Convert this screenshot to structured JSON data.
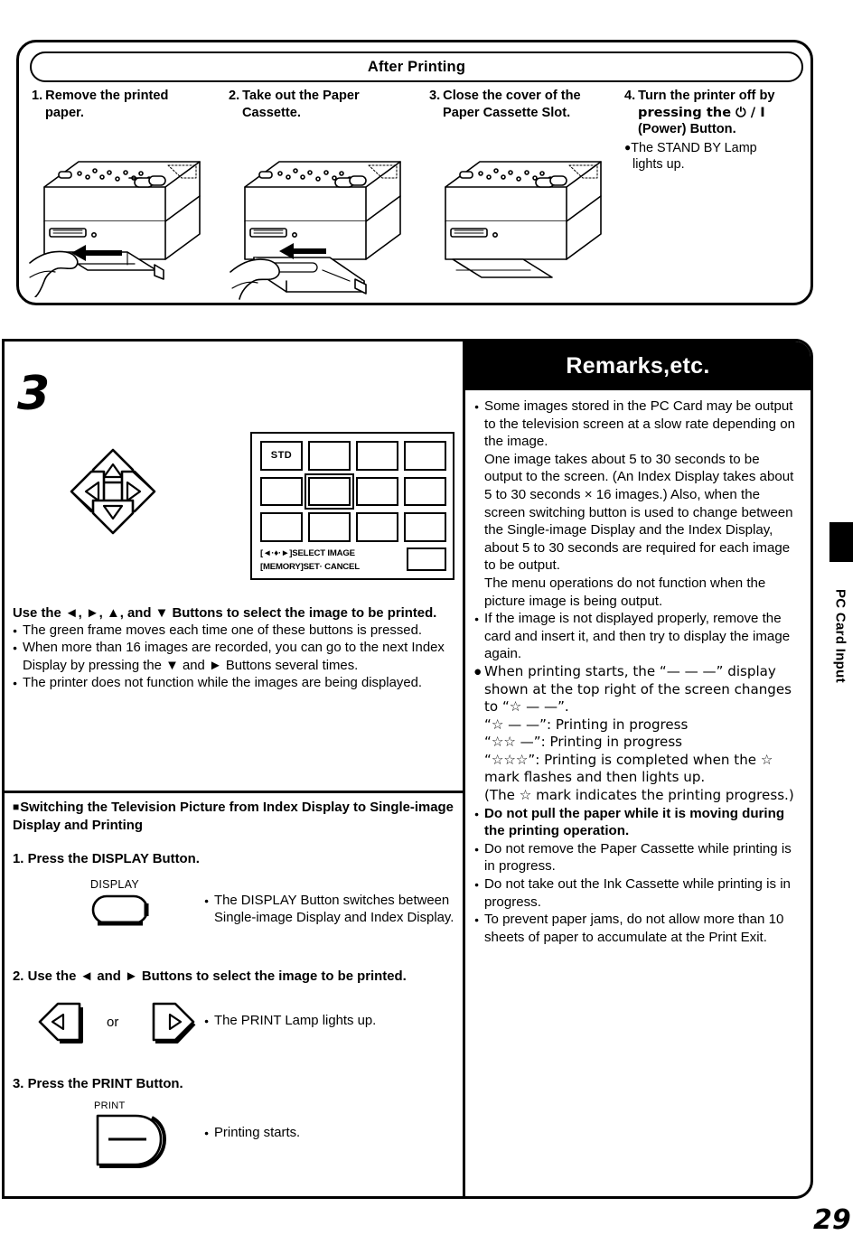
{
  "page": {
    "number": "29",
    "side_tab": "PC Card Input"
  },
  "top_box": {
    "header": "After Printing",
    "steps": [
      {
        "number": "1.",
        "title_line1": "Remove the printed",
        "title_line2": "paper.",
        "illustration": "printer-remove-printed-paper"
      },
      {
        "number": "2.",
        "title_line1": "Take out the Paper",
        "title_line2": "Cassette.",
        "illustration": "printer-take-out-paper-cassette"
      },
      {
        "number": "3.",
        "title_line1": "Close the cover of the",
        "title_line2": "Paper Cassette Slot.",
        "illustration": "printer-close-cassette-slot-cover"
      },
      {
        "number": "4.",
        "title_line1": "Turn the printer off by",
        "title_line2": "pressing the ⏻ / I",
        "title_line3": "(Power) Button.",
        "bullet_line1": "The STAND BY Lamp",
        "bullet_line2": "lights up."
      }
    ]
  },
  "left_column": {
    "step_big_number": "3",
    "dpad": {
      "up": "up-arrow",
      "down": "down-arrow",
      "left": "left-arrow",
      "right": "right-arrow"
    },
    "lcd": {
      "std_label": "STD",
      "osd_line1": "[◄·♦·►]SELECT IMAGE",
      "osd_line2": "[MEMORY]SET· CANCEL"
    },
    "instruction_heading": "Use the ◄, ►, ▲, and ▼ Buttons to select the image to be printed.",
    "bullets": [
      "The green frame moves each time one of these buttons is pressed.",
      "When more than 16 images are recorded, you can go to the next Index Display by pressing the ▼ and ► Buttons several times.",
      "The printer does not function while the images are being displayed."
    ],
    "section2": {
      "heading": "Switching the Television Picture from Index Display to Single-image Display and Printing",
      "steps": [
        {
          "number": "1.",
          "title": "Press the DISPLAY Button.",
          "button_caption": "DISPLAY",
          "note": "The DISPLAY Button switches between Single-image Display and Index Display."
        },
        {
          "number": "2.",
          "title": "Use the ◄ and ► Buttons to select the image to be printed.",
          "or_label": "or",
          "note": "The PRINT Lamp lights up."
        },
        {
          "number": "3.",
          "title": "Press the PRINT Button.",
          "button_caption": "PRINT",
          "note": "Printing starts."
        }
      ]
    }
  },
  "remarks": {
    "title": "Remarks,etc.",
    "items": [
      {
        "bold": false,
        "paragraphs": [
          "Some images stored in the PC Card may be output to the television screen at a slow rate depending on the image.",
          "One image takes about 5 to 30 seconds to be output to the screen. (An Index Display takes about 5 to 30 seconds × 16 images.) Also, when the screen switching button is used to change between the Single-image Display and the Index Display, about 5 to 30 seconds are required for each image to be output.",
          "The menu operations do not function when the picture image is being output."
        ]
      },
      {
        "bold": false,
        "paragraphs": [
          "If the image is not displayed properly, remove the card and insert it, and then try to display the image again."
        ]
      },
      {
        "bold": false,
        "paragraphs": [
          "When printing starts, the “— — —” display shown at the top right of the screen changes to “☆ — —”.",
          "“☆ — —”: Printing in progress",
          "“☆☆ —”: Printing in progress",
          "“☆☆☆”: Printing is completed when the ☆ mark flashes and then lights up.",
          "(The ☆ mark indicates the printing progress.)"
        ]
      },
      {
        "bold": true,
        "paragraphs": [
          "Do not pull the paper while it is moving during the printing operation."
        ]
      },
      {
        "bold": false,
        "paragraphs": [
          "Do not remove the Paper Cassette while printing is in progress."
        ]
      },
      {
        "bold": false,
        "paragraphs": [
          "Do not take out the Ink Cassette while printing is in progress."
        ]
      },
      {
        "bold": false,
        "paragraphs": [
          "To prevent paper jams, do not allow more than 10 sheets of paper to accumulate at the Print Exit."
        ]
      }
    ]
  }
}
